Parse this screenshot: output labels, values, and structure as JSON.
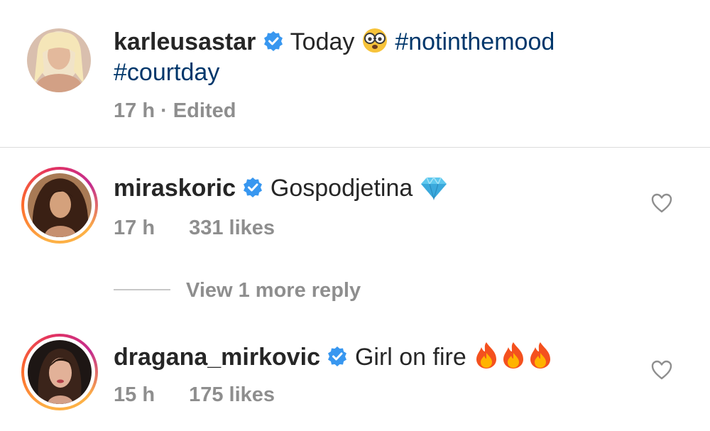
{
  "post": {
    "username": "karleusastar",
    "caption_text": "Today",
    "caption_emoji": "face-with-glasses-emoji",
    "hashtag1": "#notinthemood",
    "hashtag2": "#courtday",
    "time": "17 h",
    "edited": "· Edited"
  },
  "comments": [
    {
      "username": "miraskoric",
      "text": "Gospodjetina",
      "emoji": "gem-emoji",
      "time": "17 h",
      "likes": "331 likes"
    },
    {
      "username": "dragana_mirkovic",
      "text": "Girl on fire",
      "emoji": "fire-emoji",
      "time": "15 h",
      "likes": "175 likes"
    }
  ],
  "view_replies": "View 1 more reply",
  "icons": {
    "verified": "verified-badge-icon",
    "like": "heart-outline-icon"
  },
  "colors": {
    "hashtag": "#00376b",
    "verified": "#3897f0",
    "meta": "#8e8e8e"
  }
}
